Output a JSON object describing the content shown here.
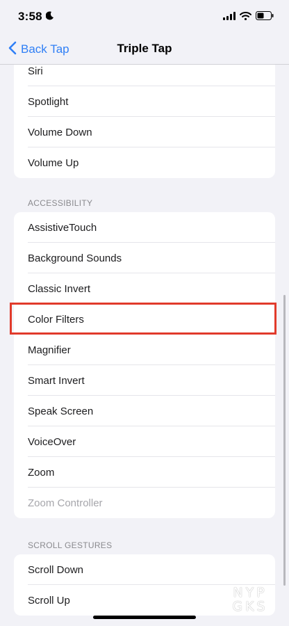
{
  "status_bar": {
    "time": "3:58"
  },
  "nav": {
    "back_label": "Back Tap",
    "title": "Triple Tap"
  },
  "groups": {
    "system": [
      {
        "label": "Siri"
      },
      {
        "label": "Spotlight"
      },
      {
        "label": "Volume Down"
      },
      {
        "label": "Volume Up"
      }
    ],
    "accessibility_header": "ACCESSIBILITY",
    "accessibility": [
      {
        "label": "AssistiveTouch"
      },
      {
        "label": "Background Sounds"
      },
      {
        "label": "Classic Invert"
      },
      {
        "label": "Color Filters"
      },
      {
        "label": "Magnifier"
      },
      {
        "label": "Smart Invert"
      },
      {
        "label": "Speak Screen"
      },
      {
        "label": "VoiceOver"
      },
      {
        "label": "Zoom"
      },
      {
        "label": "Zoom Controller"
      }
    ],
    "scroll_header": "SCROLL GESTURES",
    "scroll": [
      {
        "label": "Scroll Down"
      },
      {
        "label": "Scroll Up"
      }
    ]
  },
  "watermark": {
    "line1": "NYP",
    "line2": "GKS"
  },
  "colors": {
    "accent": "#2f7ff6",
    "highlight": "#e13a2b",
    "background": "#f2f2f7"
  }
}
